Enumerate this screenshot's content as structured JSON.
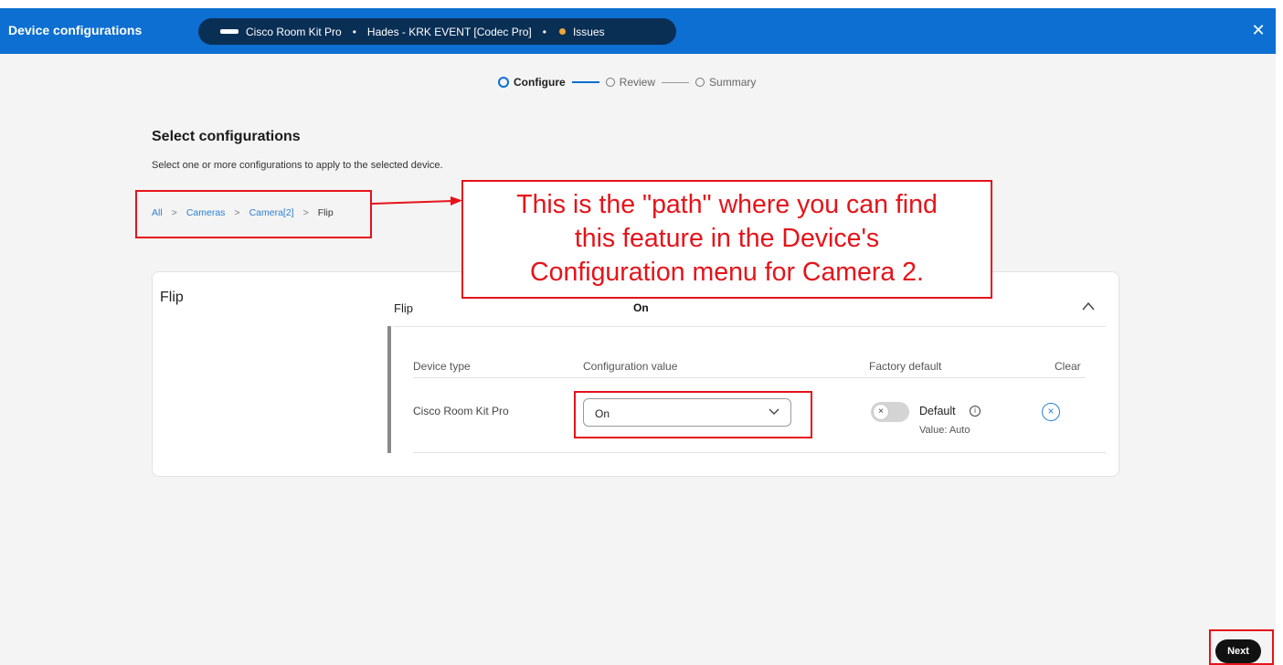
{
  "header": {
    "title": "Device configurations",
    "device_icon": "device-bar-icon",
    "device_name": "Cisco Room Kit Pro",
    "workspace": "Hades - KRK EVENT [Codec Pro]",
    "status": "Issues",
    "status_color": "#f2a73b",
    "close_label": "✕",
    "bar_color": "#0d6fd1"
  },
  "stepper": {
    "steps": [
      {
        "label": "Configure"
      },
      {
        "label": "Review"
      },
      {
        "label": "Summary"
      }
    ]
  },
  "section": {
    "title": "Select configurations",
    "description": "Select one or more configurations to apply to the selected device."
  },
  "breadcrumb": {
    "items": [
      {
        "label": "All"
      },
      {
        "label": "Cameras"
      },
      {
        "label": "Camera[2]"
      },
      {
        "label": "Flip"
      }
    ],
    "separator": ">"
  },
  "annotation": {
    "line1": "This is the \"path\" where you can find",
    "line2": "this feature in the Device's",
    "line3": "Configuration menu for Camera 2.",
    "color": "#e5131a"
  },
  "card": {
    "title": "Flip",
    "row_label": "Flip",
    "row_value": "On",
    "columns": {
      "device_type": "Device type",
      "config_value": "Configuration value",
      "factory_default": "Factory default",
      "clear": "Clear"
    },
    "row": {
      "device": "Cisco Room Kit Pro",
      "selected": "On",
      "toggle_glyph": "×",
      "default_label": "Default",
      "info_glyph": "i",
      "default_value": "Value: Auto",
      "clear_glyph": "×"
    }
  },
  "footer": {
    "next_label": "Next"
  }
}
